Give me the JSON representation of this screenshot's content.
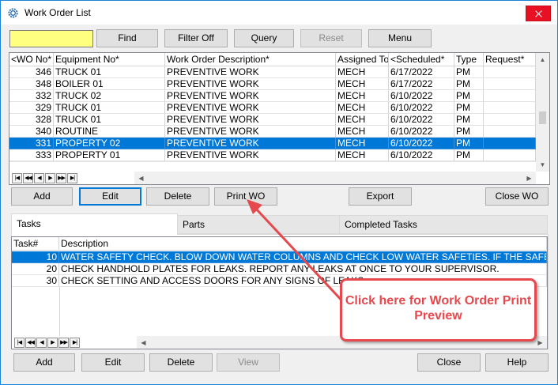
{
  "window": {
    "title": "Work Order List"
  },
  "toolbar": {
    "search_value": "",
    "find": "Find",
    "filter_off": "Filter Off",
    "query": "Query",
    "reset": "Reset",
    "menu": "Menu"
  },
  "workorders": {
    "columns": [
      "<WO No*",
      "Equipment No*",
      "Work Order Description*",
      "Assigned To",
      "<Scheduled*",
      "Type",
      "Request*"
    ],
    "rows": [
      {
        "wo": "346",
        "equip": "TRUCK 01",
        "desc": "PREVENTIVE WORK",
        "assigned": "MECH",
        "sched": "6/17/2022",
        "type": "PM",
        "request": ""
      },
      {
        "wo": "348",
        "equip": "BOILER 01",
        "desc": "PREVENTIVE WORK",
        "assigned": "MECH",
        "sched": "6/17/2022",
        "type": "PM",
        "request": ""
      },
      {
        "wo": "332",
        "equip": "TRUCK 02",
        "desc": "PREVENTIVE WORK",
        "assigned": "MECH",
        "sched": "6/10/2022",
        "type": "PM",
        "request": ""
      },
      {
        "wo": "329",
        "equip": "TRUCK 01",
        "desc": "PREVENTIVE WORK",
        "assigned": "MECH",
        "sched": "6/10/2022",
        "type": "PM",
        "request": ""
      },
      {
        "wo": "328",
        "equip": "TRUCK 01",
        "desc": "PREVENTIVE WORK",
        "assigned": "MECH",
        "sched": "6/10/2022",
        "type": "PM",
        "request": ""
      },
      {
        "wo": "340",
        "equip": "ROUTINE",
        "desc": "PREVENTIVE WORK",
        "assigned": "MECH",
        "sched": "6/10/2022",
        "type": "PM",
        "request": ""
      },
      {
        "wo": "331",
        "equip": "PROPERTY 02",
        "desc": "PREVENTIVE WORK",
        "assigned": "MECH",
        "sched": "6/10/2022",
        "type": "PM",
        "request": ""
      },
      {
        "wo": "333",
        "equip": "PROPERTY 01",
        "desc": "PREVENTIVE WORK",
        "assigned": "MECH",
        "sched": "6/10/2022",
        "type": "PM",
        "request": ""
      }
    ],
    "selected_index": 6
  },
  "wo_buttons": {
    "add": "Add",
    "edit": "Edit",
    "delete": "Delete",
    "print_wo": "Print WO",
    "export": "Export",
    "close_wo": "Close WO"
  },
  "tabs": {
    "tasks": "Tasks",
    "parts": "Parts",
    "completed": "Completed Tasks"
  },
  "tasks": {
    "columns": [
      "Task#",
      "Description"
    ],
    "rows": [
      {
        "task": "10",
        "desc": "WATER SAFETY CHECK. BLOW DOWN WATER COLUMNS AND CHECK LOW WATER SAFETIES. IF THE SAFETY MALFUNCTIONS"
      },
      {
        "task": "20",
        "desc": "CHECK HANDHOLD PLATES FOR LEAKS. REPORT ANY LEAKS AT ONCE TO YOUR SUPERVISOR."
      },
      {
        "task": "30",
        "desc": "CHECK SETTING AND ACCESS DOORS FOR ANY SIGNS OF LEAKS."
      }
    ],
    "selected_index": 0
  },
  "task_buttons": {
    "add": "Add",
    "edit": "Edit",
    "delete": "Delete",
    "view": "View",
    "close": "Close",
    "help": "Help"
  },
  "callout": {
    "text": "Click here for Work Order Print Preview",
    "color": "#e5484d"
  },
  "colors": {
    "selection": "#0078d7",
    "search_bg": "#ffff80",
    "close_red": "#e81123"
  }
}
